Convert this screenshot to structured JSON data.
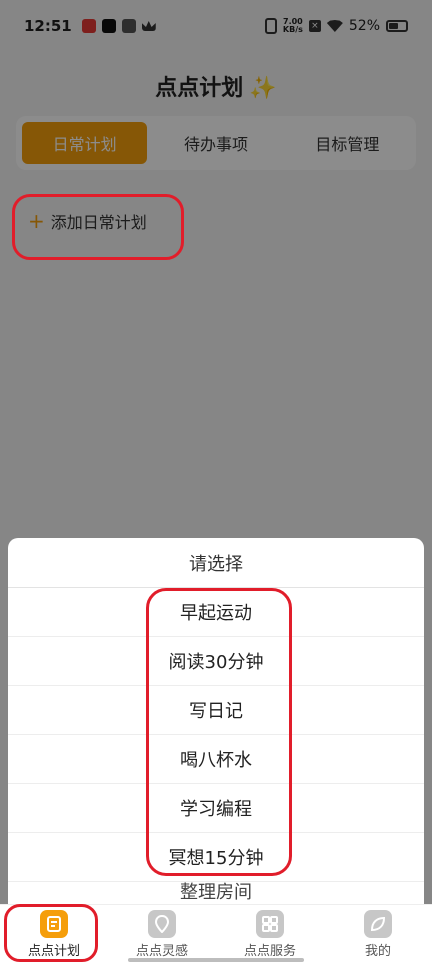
{
  "status_bar": {
    "time": "12:51",
    "speed": "7.00",
    "speed_unit": "KB/s",
    "battery": "52%"
  },
  "page": {
    "title": "点点计划",
    "sparkle": "✨"
  },
  "tabs": [
    {
      "label": "日常计划",
      "active": true
    },
    {
      "label": "待办事项",
      "active": false
    },
    {
      "label": "目标管理",
      "active": false
    }
  ],
  "add_plan": {
    "plus": "+",
    "label": "添加日常计划"
  },
  "sheet": {
    "title": "请选择",
    "options": [
      "早起运动",
      "阅读30分钟",
      "写日记",
      "喝八杯水",
      "学习编程",
      "冥想15分钟"
    ],
    "partial_option": "整理房间"
  },
  "bottom_nav": [
    {
      "label": "点点计划",
      "icon": "document-icon",
      "active": true
    },
    {
      "label": "点点灵感",
      "icon": "location-pin-icon",
      "active": false
    },
    {
      "label": "点点服务",
      "icon": "grid-icon",
      "active": false
    },
    {
      "label": "我的",
      "icon": "leaf-icon",
      "active": false
    }
  ],
  "colors": {
    "accent": "#f59e0b",
    "annotation": "#e11d2a"
  }
}
